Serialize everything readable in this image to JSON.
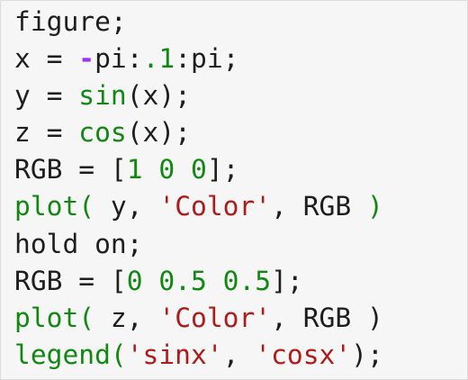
{
  "colors": {
    "plain": "#1e1e1e",
    "function": "#118811",
    "number": "#118811",
    "string": "#b11a1a",
    "operator": "#9b30ff",
    "background": "#f6f6f6"
  },
  "code": {
    "lines": [
      [
        {
          "t": "figure;",
          "c": "plain"
        }
      ],
      [
        {
          "t": "x = ",
          "c": "plain"
        },
        {
          "t": "-",
          "c": "op"
        },
        {
          "t": "pi:",
          "c": "plain"
        },
        {
          "t": ".1",
          "c": "num"
        },
        {
          "t": ":pi;",
          "c": "plain"
        }
      ],
      [
        {
          "t": "y = ",
          "c": "plain"
        },
        {
          "t": "sin",
          "c": "fn"
        },
        {
          "t": "(x);",
          "c": "plain"
        }
      ],
      [
        {
          "t": "z = ",
          "c": "plain"
        },
        {
          "t": "cos",
          "c": "fn"
        },
        {
          "t": "(x);",
          "c": "plain"
        }
      ],
      [
        {
          "t": "RGB = [",
          "c": "plain"
        },
        {
          "t": "1 0 0",
          "c": "num"
        },
        {
          "t": "];",
          "c": "plain"
        }
      ],
      [
        {
          "t": "plot(",
          "c": "fn"
        },
        {
          "t": " y, ",
          "c": "plain"
        },
        {
          "t": "'Color'",
          "c": "str"
        },
        {
          "t": ", RGB ",
          "c": "plain"
        },
        {
          "t": ")",
          "c": "fn"
        }
      ],
      [
        {
          "t": "hold on;",
          "c": "plain"
        }
      ],
      [
        {
          "t": "RGB = [",
          "c": "plain"
        },
        {
          "t": "0 0.5 0.5",
          "c": "num"
        },
        {
          "t": "];",
          "c": "plain"
        }
      ],
      [
        {
          "t": "plot(",
          "c": "fn"
        },
        {
          "t": " z, ",
          "c": "plain"
        },
        {
          "t": "'Color'",
          "c": "str"
        },
        {
          "t": ", RGB )",
          "c": "plain"
        }
      ],
      [
        {
          "t": "legend(",
          "c": "fn"
        },
        {
          "t": "'sinx'",
          "c": "str"
        },
        {
          "t": ", ",
          "c": "plain"
        },
        {
          "t": "'cosx'",
          "c": "str"
        },
        {
          "t": ");",
          "c": "plain"
        }
      ]
    ]
  }
}
